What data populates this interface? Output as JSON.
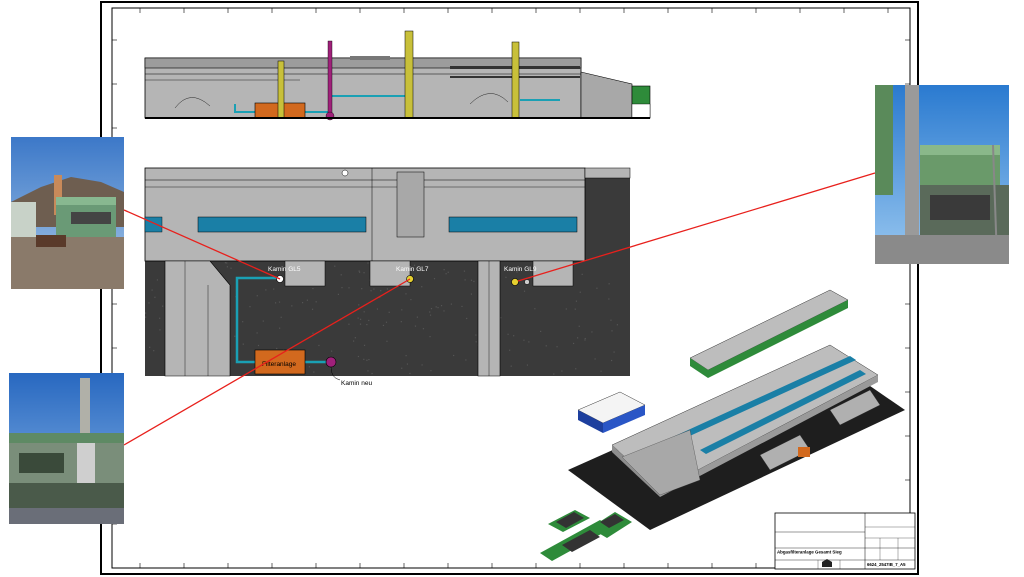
{
  "plan": {
    "chimneys": [
      {
        "label": "Kamin GL5",
        "color": "#ffffff"
      },
      {
        "label": "Kamin GL7",
        "color": "#e6d030"
      },
      {
        "label": "Kamin GL9",
        "color": "#e6d030"
      }
    ],
    "filter_label": "Filteranlage",
    "new_chimney_label": "Kamin neu"
  },
  "title_block": {
    "project": "Abgasfilteranlage Gesamt Sieg",
    "drawing_number": "6624_2547IB_7_A5"
  },
  "colors": {
    "connector": "#e8201c",
    "duct": "#1aa0b4",
    "filter": "#d2691e",
    "new_chimney": "#a0207a",
    "chimney": "#c8c03a",
    "roof_green": "#2e8b3a",
    "hall_gray": "#b5b5b5",
    "ground": "#3a3a3a"
  }
}
